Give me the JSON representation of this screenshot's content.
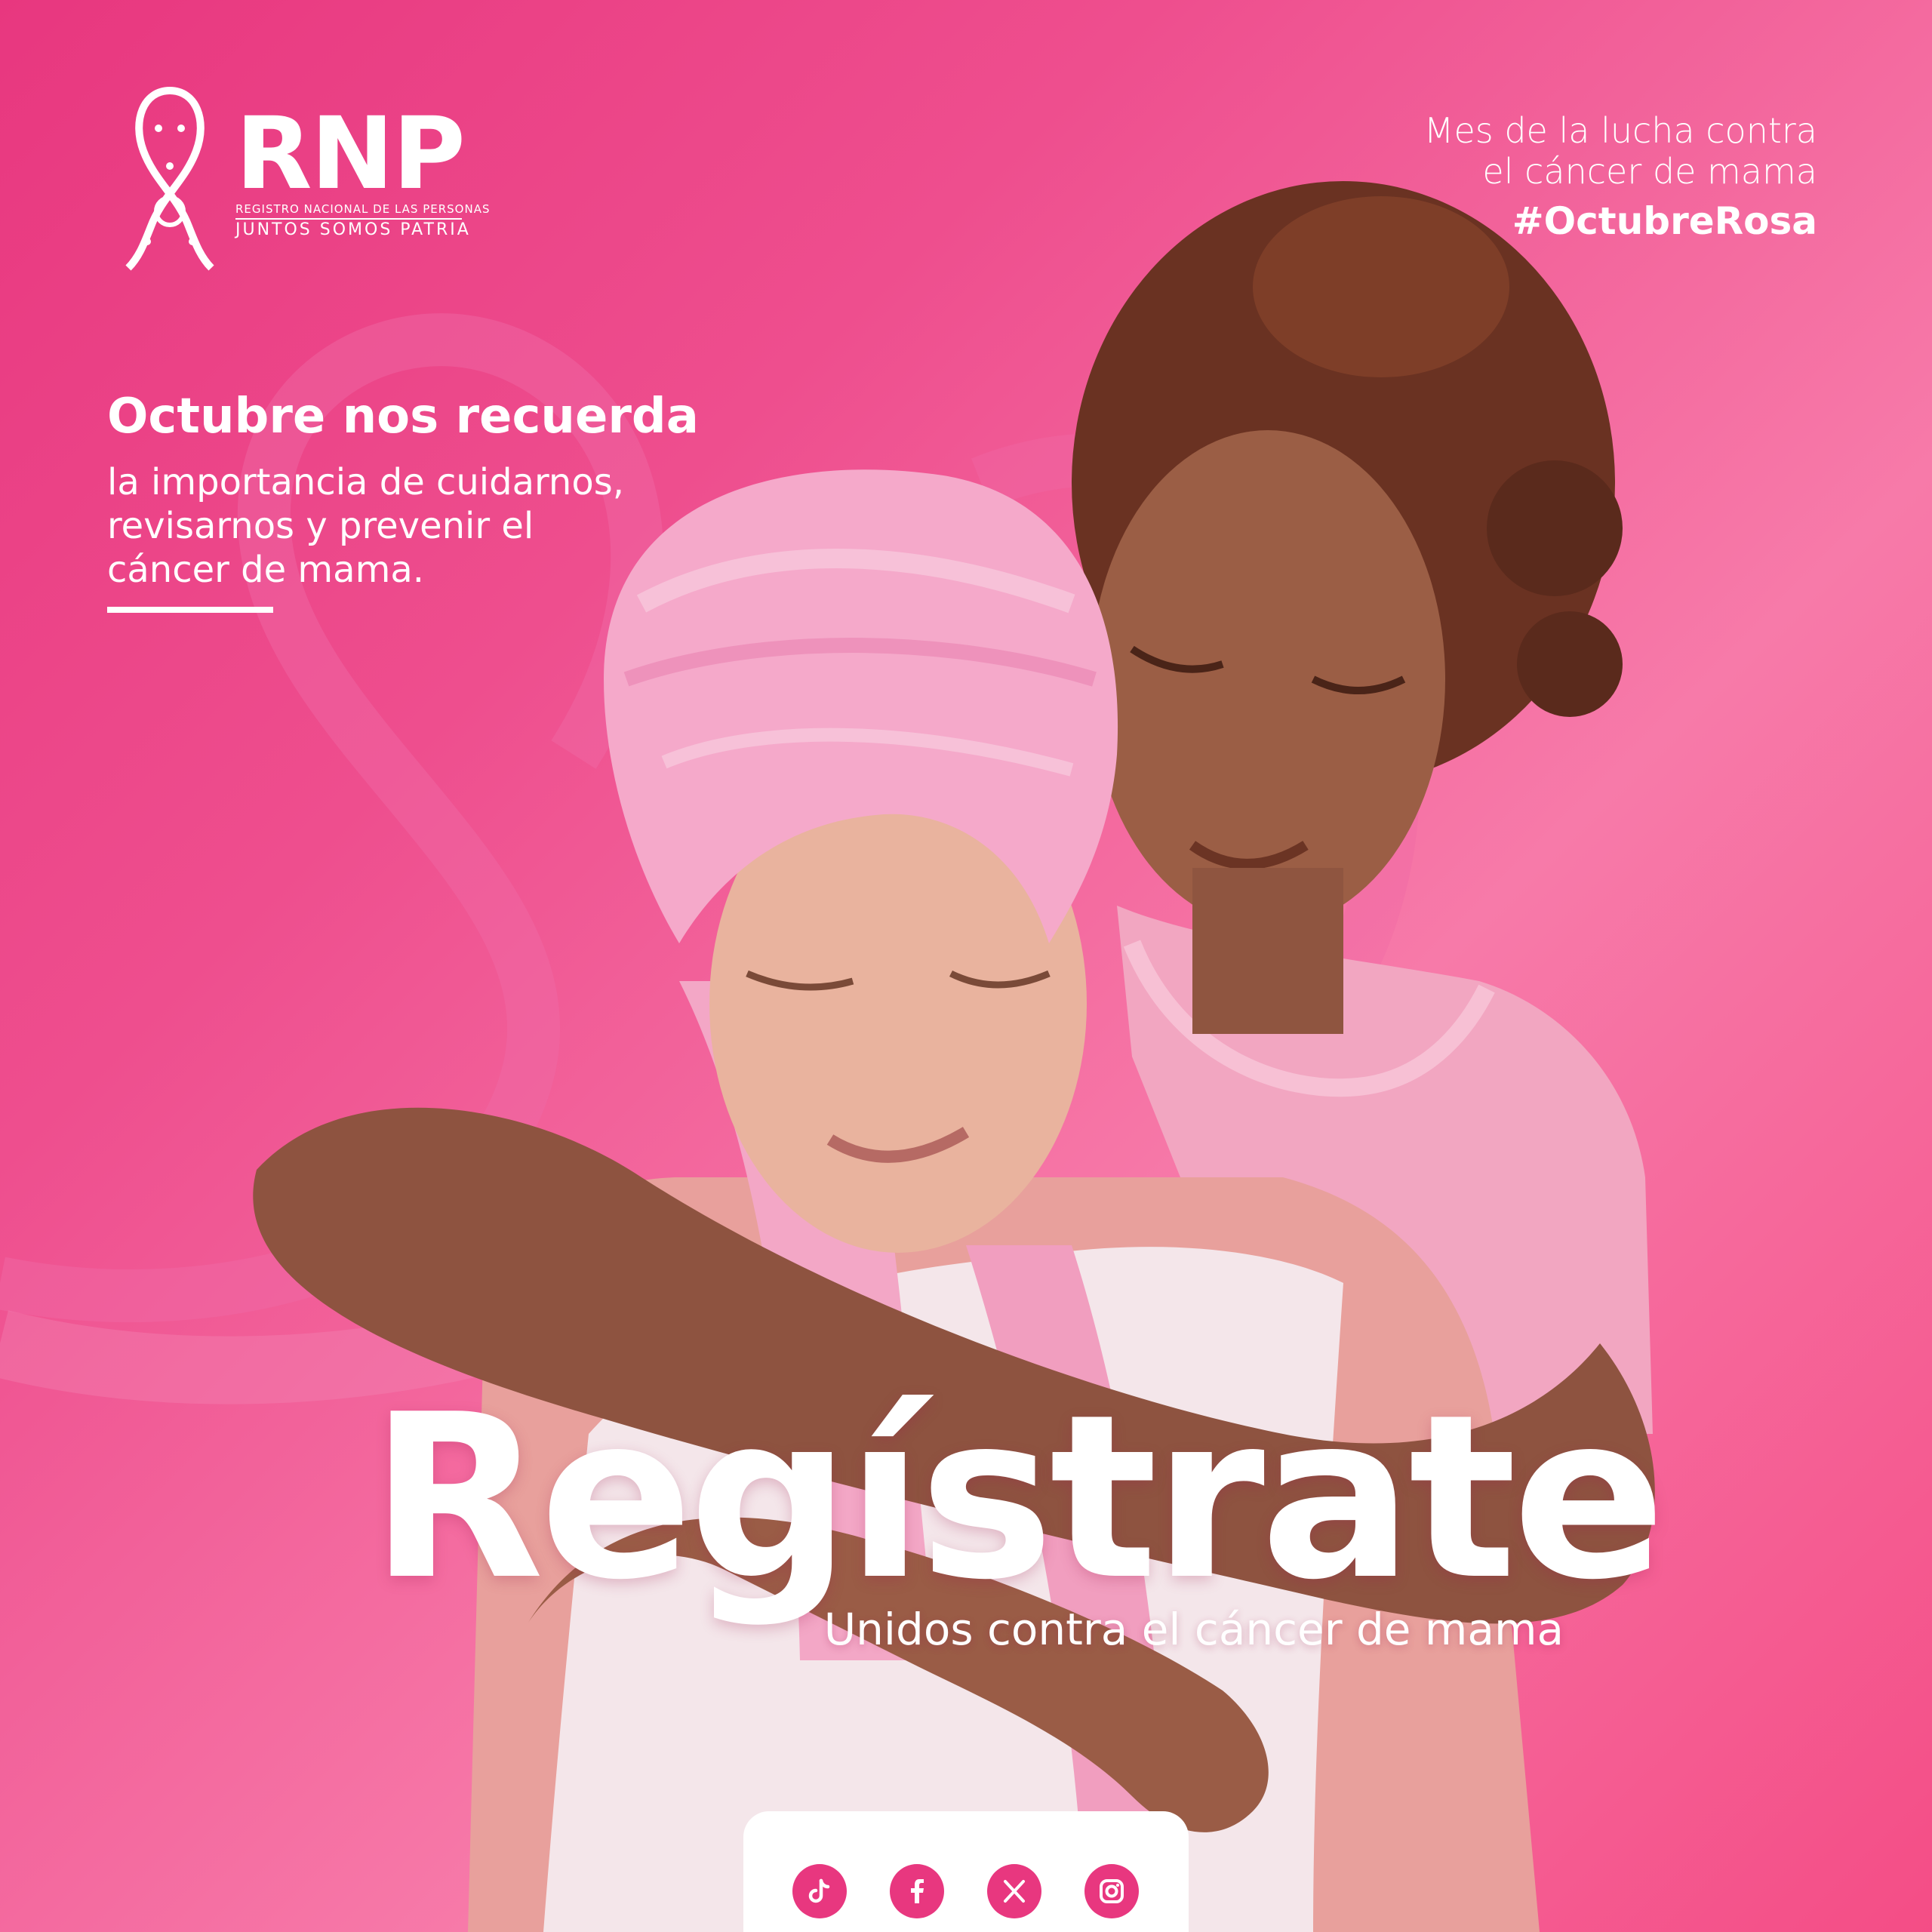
{
  "brand": {
    "wordmark": "RNP",
    "line1": "REGISTRO NACIONAL DE LAS PERSONAS",
    "line2": "JUNTOS SOMOS PATRIA"
  },
  "campaign": {
    "month_line1": "Mes de la lucha contra",
    "month_line2": "el cáncer de mama",
    "hashtag": "#OctubreRosa"
  },
  "message": {
    "title": "Octubre nos recuerda",
    "lines": [
      "la importancia de cuidarnos,",
      "revisarnos y prevenir el",
      "cáncer de mama."
    ]
  },
  "headline": "Regístrate",
  "tagline": "Unidos contra el cáncer de mama",
  "colors": {
    "primary_pink": "#e8377f",
    "light_pink": "#f77aa9",
    "white": "#ffffff"
  },
  "social": [
    {
      "icon": "tiktok-icon"
    },
    {
      "icon": "facebook-icon"
    },
    {
      "icon": "x-icon"
    },
    {
      "icon": "instagram-icon"
    }
  ]
}
